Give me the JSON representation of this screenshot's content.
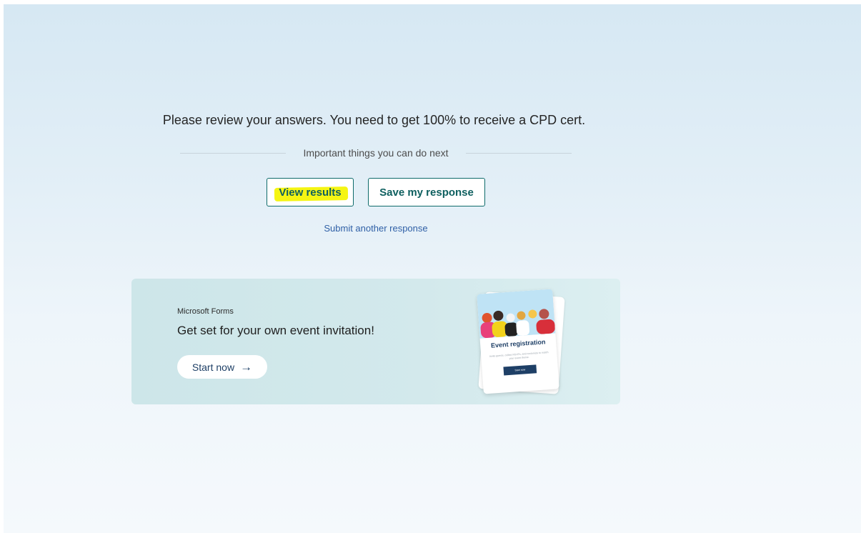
{
  "confirmation": {
    "message": "Please review your answers. You need to get 100% to receive a CPD cert.",
    "next_steps_label": "Important things you can do next"
  },
  "actions": {
    "view_results_label": "View results",
    "save_response_label": "Save my response",
    "submit_another_label": "Submit another response"
  },
  "promo": {
    "brand": "Microsoft Forms",
    "title": "Get set for your own event invitation!",
    "cta_label": "Start now",
    "cta_icon": "arrow-right-icon",
    "card": {
      "title": "Event registration",
      "subtitle": "Invite guests, collect RSVPs, and customize to match your event theme.",
      "button_label": "Start now"
    }
  },
  "colors": {
    "accent": "#0e6b6b",
    "link": "#2f5fa6",
    "highlight": "#f5f513",
    "promo_bg": "#cde6e9",
    "card_accent": "#1e3f66"
  }
}
